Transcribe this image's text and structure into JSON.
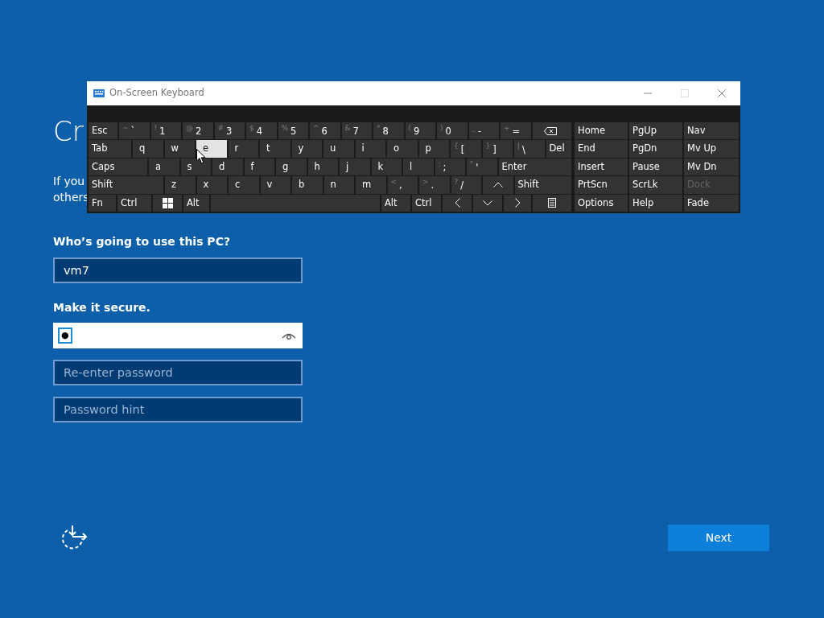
{
  "page": {
    "heading": "Cr",
    "intro_lines": [
      "If you",
      "others"
    ]
  },
  "username": {
    "label": "Who’s going to use this PC?",
    "value": "vm7"
  },
  "password": {
    "label": "Make it secure.",
    "value": "●",
    "focused": true
  },
  "fields": [
    {
      "placeholder": "Re-enter password"
    },
    {
      "placeholder": "Password hint"
    }
  ],
  "next_button": "Next",
  "keyboard": {
    "title": "On-Screen Keyboard",
    "rows": [
      [
        {
          "kind": "label",
          "label": "Esc",
          "pressed": false
        },
        {
          "kind": "char",
          "shift": "~",
          "main": "`",
          "pressed": false
        },
        {
          "kind": "char",
          "shift": "!",
          "main": "1",
          "pressed": false
        },
        {
          "kind": "char",
          "shift": "@",
          "main": "2",
          "pressed": false
        },
        {
          "kind": "char",
          "shift": "#",
          "main": "3",
          "pressed": false
        },
        {
          "kind": "char",
          "shift": "$",
          "main": "4",
          "pressed": false
        },
        {
          "kind": "char",
          "shift": "%",
          "main": "5",
          "pressed": false
        },
        {
          "kind": "char",
          "shift": "^",
          "main": "6",
          "pressed": false
        },
        {
          "kind": "char",
          "shift": "&",
          "main": "7",
          "pressed": false
        },
        {
          "kind": "char",
          "shift": "*",
          "main": "8",
          "pressed": false
        },
        {
          "kind": "char",
          "shift": "(",
          "main": "9",
          "pressed": false
        },
        {
          "kind": "char",
          "shift": ")",
          "main": "0",
          "pressed": false
        },
        {
          "kind": "char",
          "shift": "_",
          "main": "-",
          "pressed": false
        },
        {
          "kind": "char",
          "shift": "+",
          "main": "=",
          "pressed": false
        },
        {
          "kind": "backspace",
          "pressed": false
        }
      ],
      [
        {
          "kind": "label",
          "label": "Tab",
          "pressed": false
        },
        {
          "kind": "char",
          "main": "q",
          "pressed": false
        },
        {
          "kind": "char",
          "main": "w",
          "pressed": false
        },
        {
          "kind": "char",
          "main": "e",
          "pressed": true
        },
        {
          "kind": "char",
          "main": "r",
          "pressed": false
        },
        {
          "kind": "char",
          "main": "t",
          "pressed": false
        },
        {
          "kind": "char",
          "main": "y",
          "pressed": false
        },
        {
          "kind": "char",
          "main": "u",
          "pressed": false
        },
        {
          "kind": "char",
          "main": "i",
          "pressed": false
        },
        {
          "kind": "char",
          "main": "o",
          "pressed": false
        },
        {
          "kind": "char",
          "main": "p",
          "pressed": false
        },
        {
          "kind": "char",
          "shift": "{",
          "main": "[",
          "pressed": false
        },
        {
          "kind": "char",
          "shift": "}",
          "main": "]",
          "pressed": false
        },
        {
          "kind": "char",
          "shift": "|",
          "main": "\\",
          "pressed": false
        },
        {
          "kind": "label",
          "label": "Del",
          "pressed": false
        }
      ],
      [
        {
          "kind": "label",
          "label": "Caps",
          "pressed": false
        },
        {
          "kind": "char",
          "main": "a",
          "pressed": false
        },
        {
          "kind": "char",
          "main": "s",
          "pressed": false
        },
        {
          "kind": "char",
          "main": "d",
          "pressed": false
        },
        {
          "kind": "char",
          "main": "f",
          "pressed": false
        },
        {
          "kind": "char",
          "main": "g",
          "pressed": false
        },
        {
          "kind": "char",
          "main": "h",
          "pressed": false
        },
        {
          "kind": "char",
          "main": "j",
          "pressed": false
        },
        {
          "kind": "char",
          "main": "k",
          "pressed": false
        },
        {
          "kind": "char",
          "main": "l",
          "pressed": false
        },
        {
          "kind": "char",
          "shift": ":",
          "main": ";",
          "pressed": false
        },
        {
          "kind": "char",
          "shift": "\"",
          "main": "'",
          "pressed": false
        },
        {
          "kind": "label",
          "label": "Enter",
          "pressed": false
        }
      ],
      [
        {
          "kind": "label",
          "label": "Shift",
          "pressed": false
        },
        {
          "kind": "char",
          "main": "z",
          "pressed": false
        },
        {
          "kind": "char",
          "main": "x",
          "pressed": false
        },
        {
          "kind": "char",
          "main": "c",
          "pressed": false
        },
        {
          "kind": "char",
          "main": "v",
          "pressed": false
        },
        {
          "kind": "char",
          "main": "b",
          "pressed": false
        },
        {
          "kind": "char",
          "main": "n",
          "pressed": false
        },
        {
          "kind": "char",
          "main": "m",
          "pressed": false
        },
        {
          "kind": "char",
          "shift": "<",
          "main": ",",
          "pressed": false
        },
        {
          "kind": "char",
          "shift": ">",
          "main": ".",
          "pressed": false
        },
        {
          "kind": "char",
          "shift": "?",
          "main": "/",
          "pressed": false
        },
        {
          "kind": "up",
          "pressed": false
        },
        {
          "kind": "label",
          "label": "Shift",
          "pressed": false
        }
      ],
      [
        {
          "kind": "label",
          "label": "Fn",
          "pressed": false
        },
        {
          "kind": "label",
          "label": "Ctrl",
          "pressed": false
        },
        {
          "kind": "windows",
          "pressed": false
        },
        {
          "kind": "label",
          "label": "Alt",
          "pressed": false
        },
        {
          "kind": "space",
          "pressed": false
        },
        {
          "kind": "label",
          "label": "Alt",
          "pressed": false
        },
        {
          "kind": "label",
          "label": "Ctrl",
          "pressed": false
        },
        {
          "kind": "left",
          "pressed": false
        },
        {
          "kind": "down",
          "pressed": false
        },
        {
          "kind": "right",
          "pressed": false
        },
        {
          "kind": "menu",
          "pressed": false
        }
      ]
    ],
    "nav_rows": [
      [
        {
          "label": "Home",
          "disabled": false
        },
        {
          "label": "PgUp",
          "disabled": false
        },
        {
          "label": "Nav",
          "disabled": false
        }
      ],
      [
        {
          "label": "End",
          "disabled": false
        },
        {
          "label": "PgDn",
          "disabled": false
        },
        {
          "label": "Mv Up",
          "disabled": false
        }
      ],
      [
        {
          "label": "Insert",
          "disabled": false
        },
        {
          "label": "Pause",
          "disabled": false
        },
        {
          "label": "Mv Dn",
          "disabled": false
        }
      ],
      [
        {
          "label": "PrtScn",
          "disabled": false
        },
        {
          "label": "ScrLk",
          "disabled": false
        },
        {
          "label": "Dock",
          "disabled": true
        }
      ],
      [
        {
          "label": "Options",
          "disabled": false
        },
        {
          "label": "Help",
          "disabled": false
        },
        {
          "label": "Fade",
          "disabled": false
        }
      ]
    ]
  }
}
